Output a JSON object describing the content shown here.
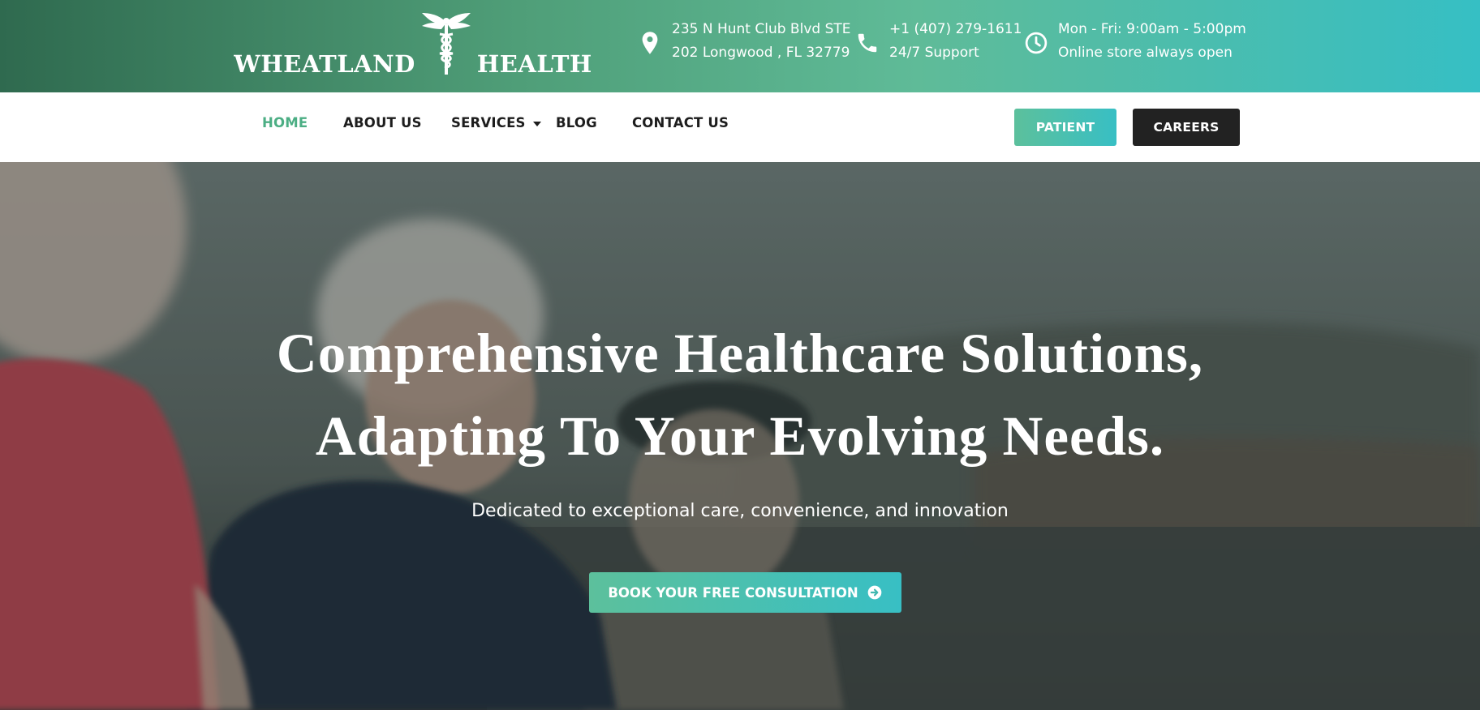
{
  "brand": {
    "name_left": "WHEATLAND",
    "name_right": "HEALTH",
    "logo_icon": "caduceus-icon"
  },
  "topbar": {
    "address": {
      "icon": "location-pin-icon",
      "line1": "235 N Hunt Club Blvd STE",
      "line2": "202 Longwood , FL 32779"
    },
    "phone": {
      "icon": "phone-icon",
      "line1": "+1 (407) 279-1611",
      "line2": "24/7 Support"
    },
    "hours": {
      "icon": "clock-icon",
      "line1": "Mon - Fri: 9:00am - 5:00pm",
      "line2": "Online store always open"
    }
  },
  "nav": {
    "items": [
      {
        "label": "HOME",
        "active": true
      },
      {
        "label": "ABOUT US"
      },
      {
        "label": "SERVICES",
        "has_dropdown": true
      },
      {
        "label": "BLOG"
      },
      {
        "label": "CONTACT US"
      }
    ],
    "patient_button": "PATIENT",
    "careers_button": "CAREERS"
  },
  "hero": {
    "title_line1": "Comprehensive Healthcare Solutions,",
    "title_line2": "Adapting To Your Evolving Needs.",
    "subtitle": "Dedicated to exceptional care, convenience, and innovation",
    "cta_label": "BOOK YOUR FREE CONSULTATION",
    "cta_icon": "arrow-circle-right-icon"
  },
  "colors": {
    "accent": "#4cae84",
    "accent_teal": "#38bfc4",
    "topbar_dark": "#2f6a4f",
    "dark_button": "#222222"
  }
}
